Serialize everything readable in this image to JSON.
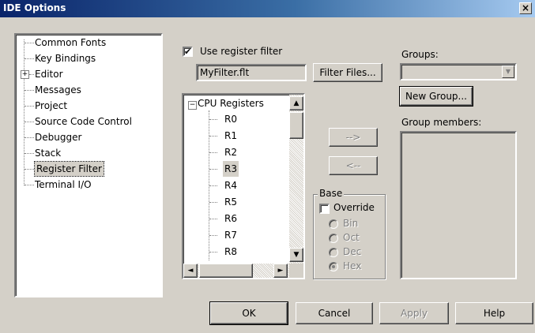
{
  "window": {
    "title": "IDE Options",
    "close": "×"
  },
  "categories": {
    "items": [
      {
        "label": "Common Fonts"
      },
      {
        "label": "Key Bindings"
      },
      {
        "label": "Editor",
        "expander": "+"
      },
      {
        "label": "Messages"
      },
      {
        "label": "Project"
      },
      {
        "label": "Source Code Control"
      },
      {
        "label": "Debugger"
      },
      {
        "label": "Stack"
      },
      {
        "label": "Register Filter",
        "selected": true
      },
      {
        "label": "Terminal I/O"
      }
    ]
  },
  "filter": {
    "use_label": "Use register filter",
    "use_checked": true,
    "check_glyph": "✔",
    "file_value": "MyFilter.flt",
    "filter_files_button": "Filter Files..."
  },
  "register_tree": {
    "root_expander": "−",
    "root_label": "CPU Registers",
    "items": [
      "R0",
      "R1",
      "R2",
      "R3",
      "R4",
      "R5",
      "R6",
      "R7",
      "R8"
    ],
    "selected": "R3",
    "scroll_up": "▲",
    "scroll_down": "▼",
    "scroll_left": "◄",
    "scroll_right": "►"
  },
  "transfer": {
    "add_label": "-->",
    "remove_label": "<--"
  },
  "base": {
    "label": "Base",
    "override_label": "Override",
    "override_checked": false,
    "options": [
      {
        "label": "Bin",
        "checked": false
      },
      {
        "label": "Oct",
        "checked": false
      },
      {
        "label": "Dec",
        "checked": false
      },
      {
        "label": "Hex",
        "checked": true
      }
    ]
  },
  "groups": {
    "label": "Groups:",
    "value": "",
    "dropdown_arrow": "▼",
    "new_group_button": "New Group...",
    "members_label": "Group members:"
  },
  "footer": {
    "ok": "OK",
    "cancel": "Cancel",
    "apply": "Apply",
    "help": "Help"
  }
}
